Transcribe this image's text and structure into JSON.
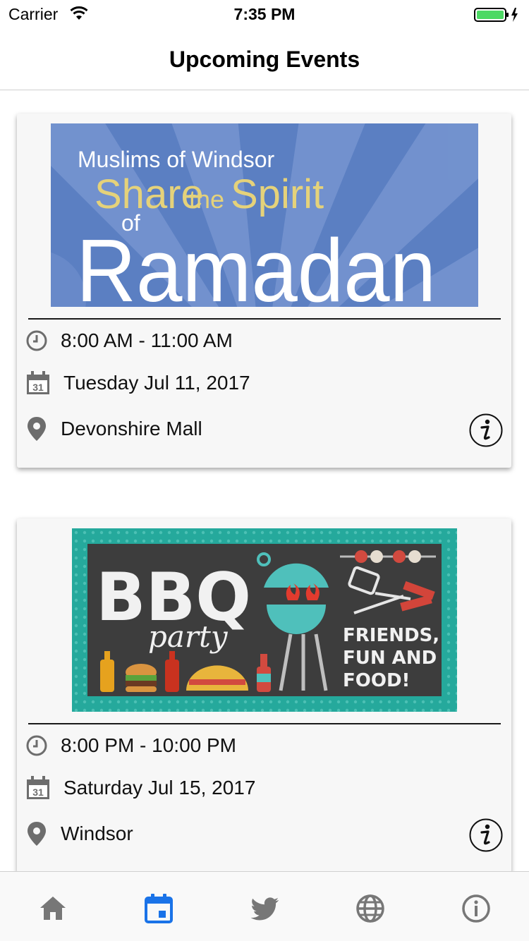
{
  "status_bar": {
    "carrier": "Carrier",
    "time": "7:35 PM"
  },
  "nav": {
    "title": "Upcoming Events"
  },
  "colors": {
    "accent": "#1a73e8",
    "tab_inactive": "#777777",
    "icon_gray": "#6d6d6d"
  },
  "events": [
    {
      "banner": {
        "line1": "Muslims of Windsor",
        "line2a": "Share",
        "line2b": "the",
        "line2c": "Spirit",
        "line3": "of",
        "line4": "Ramadan"
      },
      "time": "8:00 AM - 11:00 AM",
      "date": "Tuesday Jul 11, 2017",
      "location": "Devonshire Mall",
      "calendar_day": "31"
    },
    {
      "banner": {
        "title": "BBQ",
        "subtitle": "party",
        "tag1": "FRIENDS,",
        "tag2": "FUN AND",
        "tag3": "FOOD!"
      },
      "time": "8:00 PM - 10:00 PM",
      "date": "Saturday Jul 15, 2017",
      "location": "Windsor",
      "calendar_day": "31"
    }
  ],
  "tabs": [
    {
      "icon": "home-icon",
      "active": false
    },
    {
      "icon": "calendar-icon",
      "active": true
    },
    {
      "icon": "twitter-icon",
      "active": false
    },
    {
      "icon": "globe-icon",
      "active": false
    },
    {
      "icon": "info-icon",
      "active": false
    }
  ]
}
